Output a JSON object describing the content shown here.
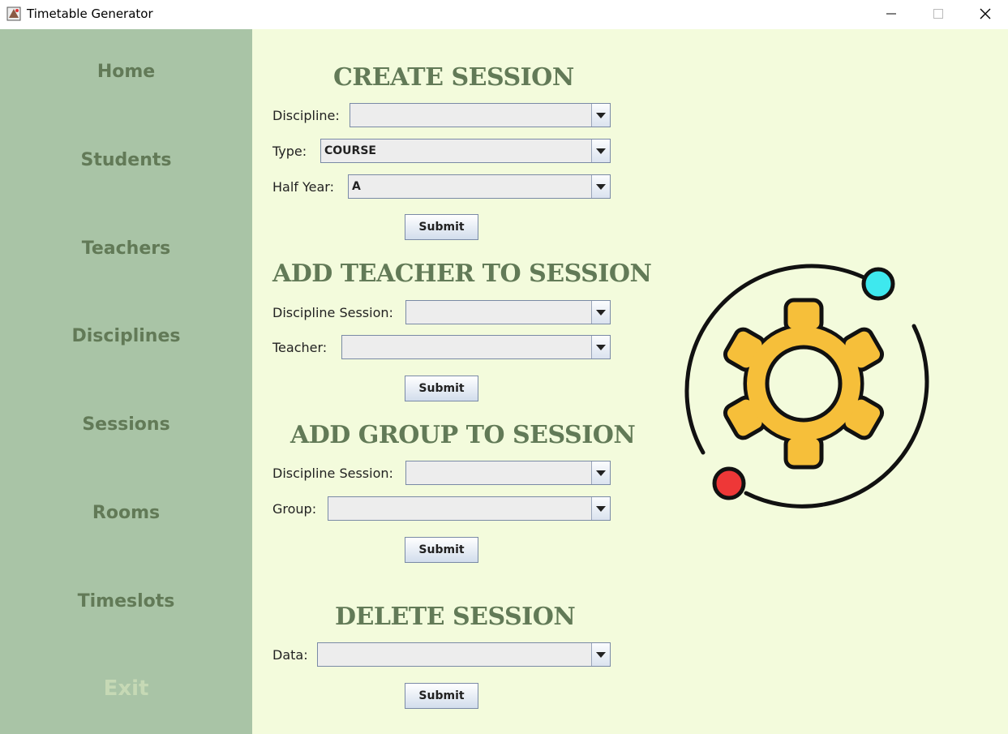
{
  "window": {
    "title": "Timetable Generator"
  },
  "sidebar": {
    "items": [
      {
        "label": "Home"
      },
      {
        "label": "Students"
      },
      {
        "label": "Teachers"
      },
      {
        "label": "Disciplines"
      },
      {
        "label": "Sessions"
      },
      {
        "label": "Rooms"
      },
      {
        "label": "Timeslots"
      },
      {
        "label": "Exit"
      }
    ]
  },
  "create_session": {
    "title": "CREATE SESSION",
    "discipline_label": "Discipline:",
    "discipline_value": "",
    "type_label": "Type:",
    "type_value": "COURSE",
    "half_year_label": "Half Year:",
    "half_year_value": "A",
    "submit_label": "Submit"
  },
  "add_teacher": {
    "title": "ADD TEACHER TO SESSION",
    "discipline_session_label": "Discipline Session:",
    "discipline_session_value": "",
    "teacher_label": "Teacher:",
    "teacher_value": "",
    "submit_label": "Submit"
  },
  "add_group": {
    "title": "ADD GROUP TO SESSION",
    "discipline_session_label": "Discipline Session:",
    "discipline_session_value": "",
    "group_label": "Group:",
    "group_value": "",
    "submit_label": "Submit"
  },
  "delete_session": {
    "title": "DELETE SESSION",
    "data_label": "Data:",
    "data_value": "",
    "submit_label": "Submit"
  },
  "illustration": {
    "icon": "gear-orbit-icon",
    "colors": {
      "gear": "#f6bf3a",
      "planet_cyan": "#3ee8ee",
      "planet_red": "#ee3737"
    }
  },
  "colors": {
    "sidebar_bg": "#a9c4a6",
    "main_bg": "#f3fbdc",
    "accent_text": "#627a57",
    "exit_text": "#c6d9b5"
  }
}
